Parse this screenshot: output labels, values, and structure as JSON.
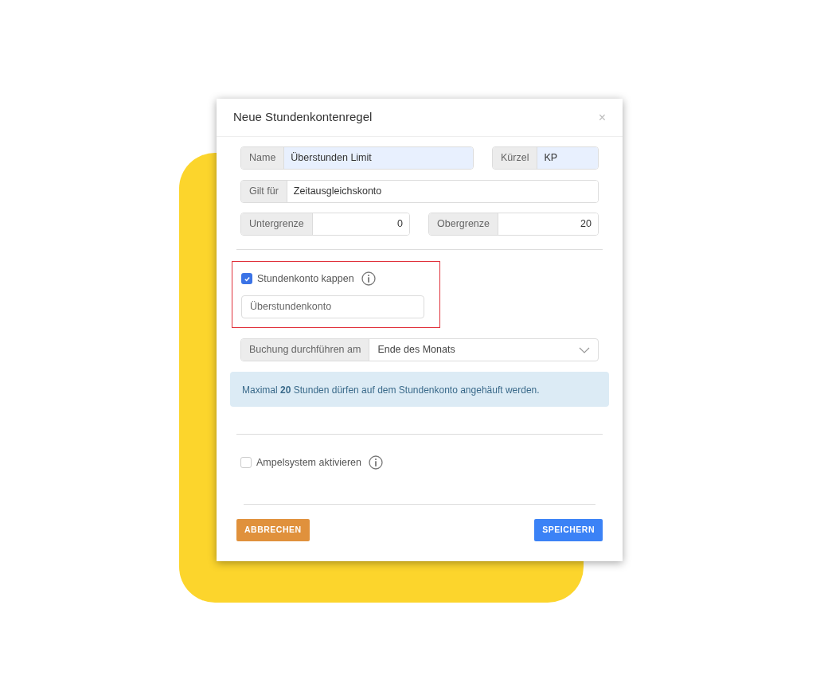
{
  "dialog": {
    "title": "Neue Stundenkontenregel",
    "close": "×",
    "name_field": {
      "label": "Name",
      "value": "Überstunden Limit"
    },
    "short_field": {
      "label": "Kürzel",
      "value": "KP"
    },
    "applies_field": {
      "label": "Gilt für",
      "value": "Zeitausgleichskonto"
    },
    "lower_field": {
      "label": "Untergrenze",
      "value": "0"
    },
    "upper_field": {
      "label": "Obergrenze",
      "value": "20"
    },
    "cap": {
      "label": "Stundenkonto kappen",
      "checked": true,
      "highlighted": true,
      "account": {
        "value": "Überstundenkonto"
      }
    },
    "booking": {
      "label": "Buchung durchführen am",
      "value": "Ende des Monats"
    },
    "alert": "Maximal **20** Stunden dürfen auf dem Stundenkonto angehäuft werden.",
    "traffic_light": {
      "label": "Ampelsystem aktivieren",
      "checked": false
    },
    "buttons": [
      {
        "label": "ABBRECHEN",
        "kind": "cancel"
      },
      {
        "label": "SPEICHERN",
        "kind": "save"
      }
    ]
  }
}
